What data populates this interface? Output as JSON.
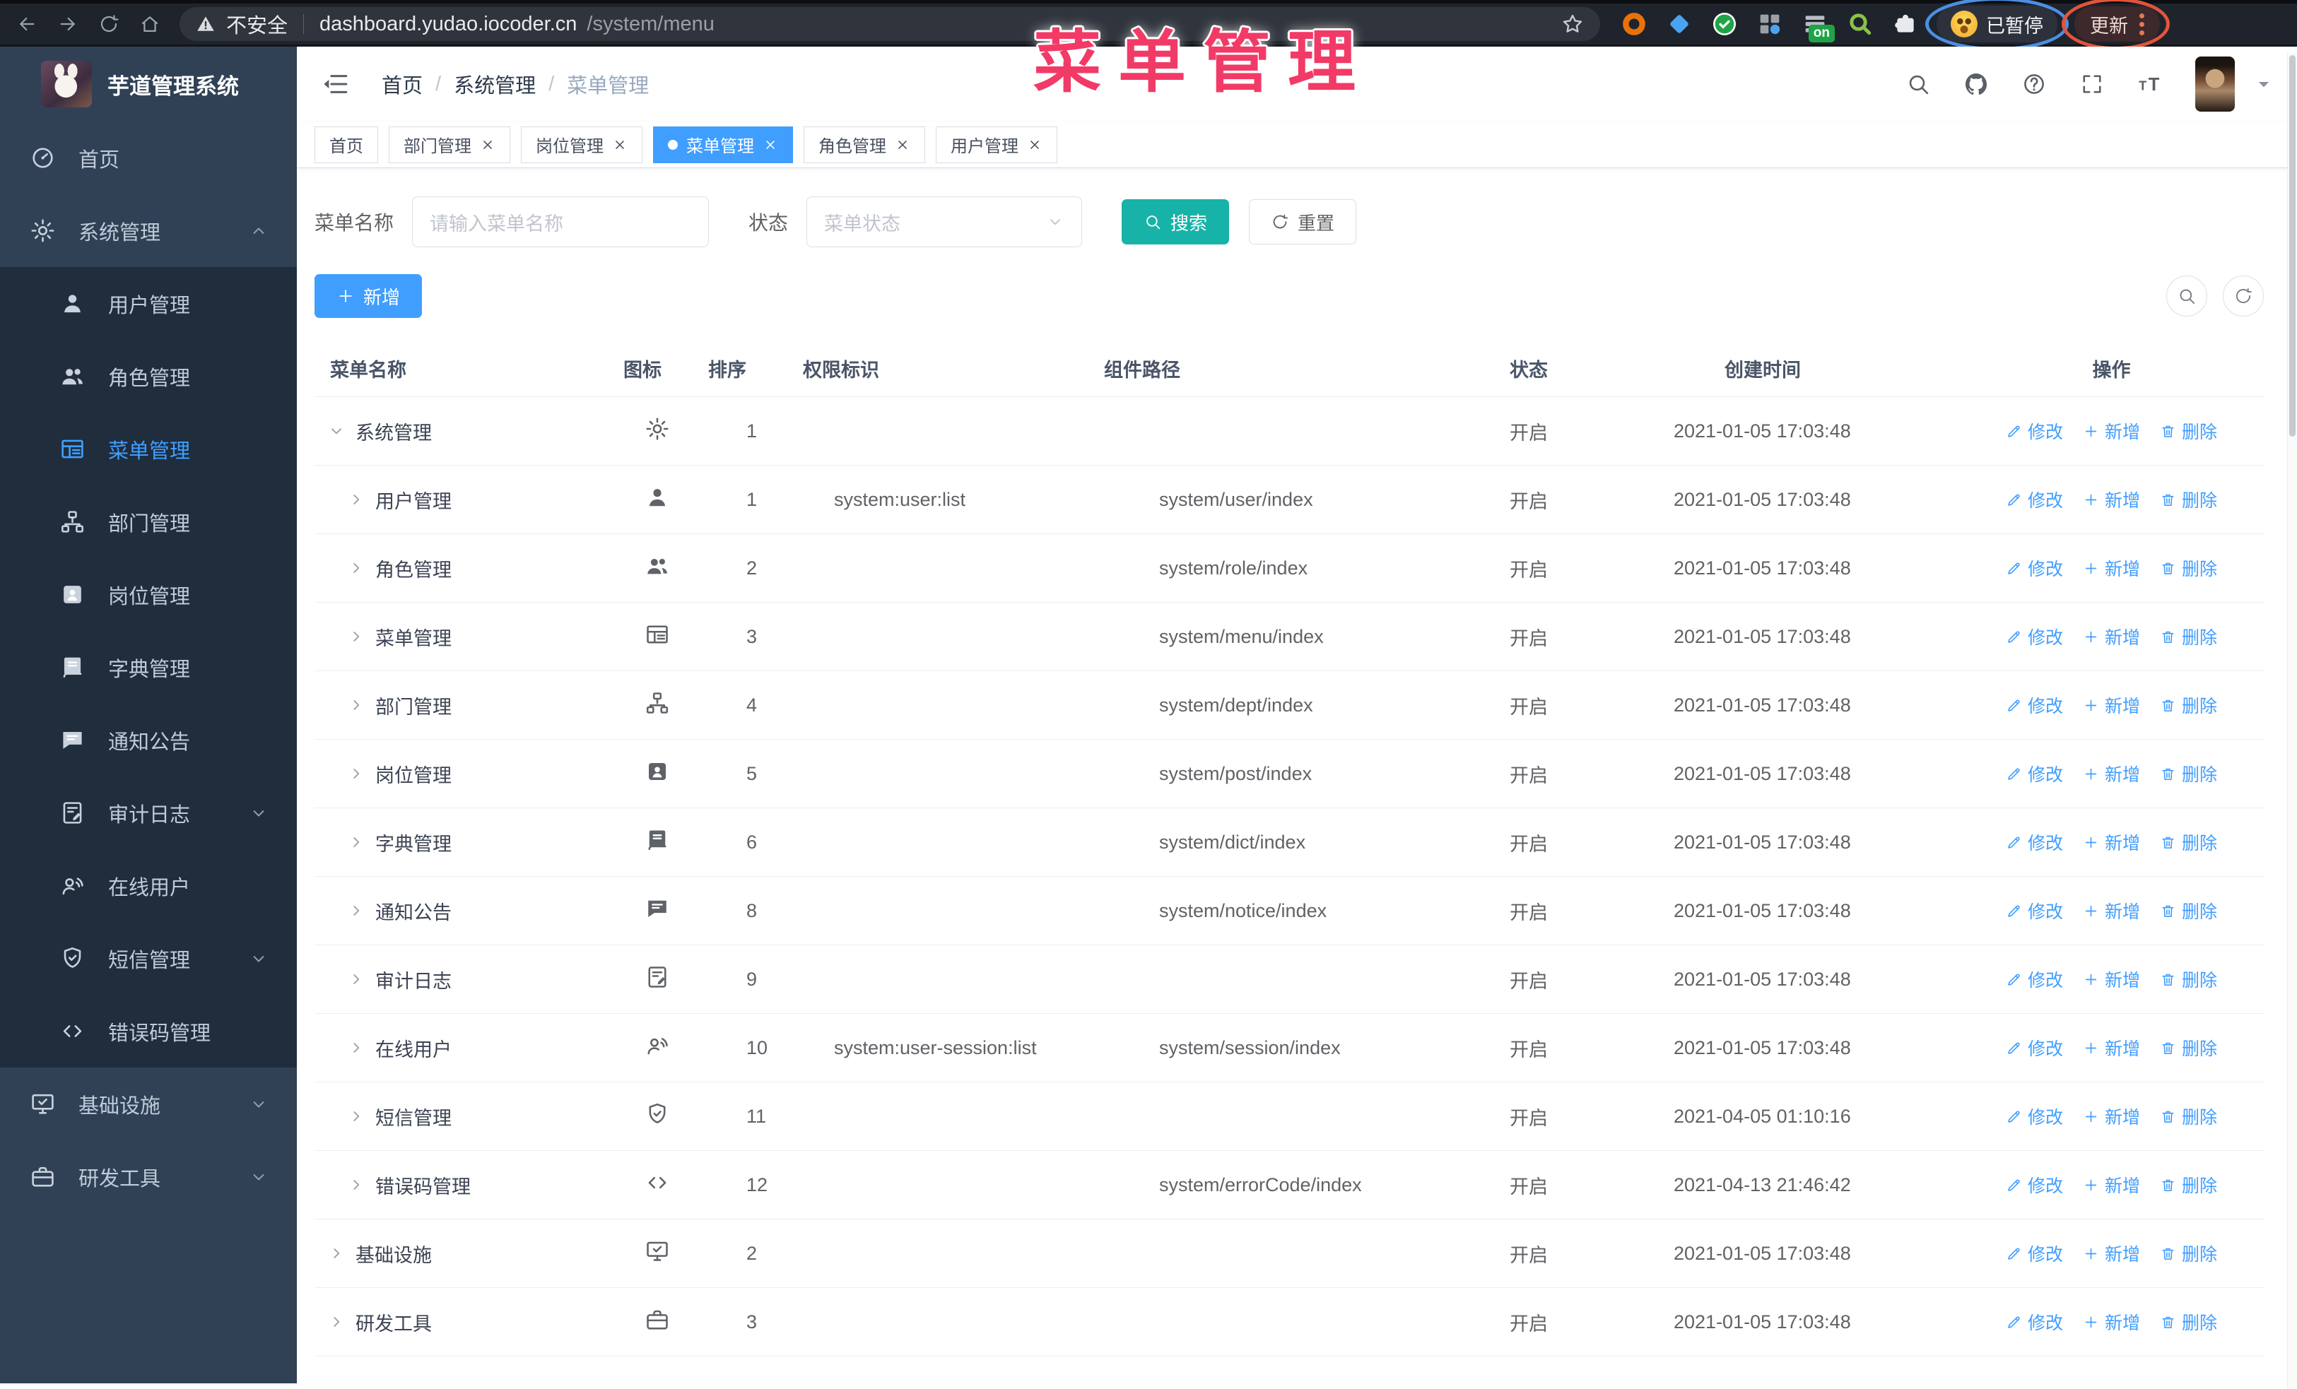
{
  "browser": {
    "security_label": "不安全",
    "url_host": "dashboard.yudao.iocoder.cn",
    "url_path": "/system/menu",
    "on_badge": "on",
    "paused_badge": "已暂停",
    "update_label": "更新"
  },
  "overlay_title": "菜单管理",
  "sidebar": {
    "logo_title": "芋道管理系统",
    "items": [
      {
        "label": "首页",
        "icon": "dashboard",
        "level": 1
      },
      {
        "label": "系统管理",
        "icon": "gear",
        "level": 1,
        "chevron": "up",
        "expanded": true
      },
      {
        "label": "用户管理",
        "icon": "user",
        "level": 2
      },
      {
        "label": "角色管理",
        "icon": "users",
        "level": 2
      },
      {
        "label": "菜单管理",
        "icon": "tree-table",
        "level": 2,
        "active": true
      },
      {
        "label": "部门管理",
        "icon": "tree",
        "level": 2
      },
      {
        "label": "岗位管理",
        "icon": "post",
        "level": 2
      },
      {
        "label": "字典管理",
        "icon": "dict",
        "level": 2
      },
      {
        "label": "通知公告",
        "icon": "message",
        "level": 2
      },
      {
        "label": "审计日志",
        "icon": "log",
        "level": 2,
        "chevron": "down"
      },
      {
        "label": "在线用户",
        "icon": "online",
        "level": 2
      },
      {
        "label": "短信管理",
        "icon": "sms",
        "level": 2,
        "chevron": "down"
      },
      {
        "label": "错误码管理",
        "icon": "code",
        "level": 2
      },
      {
        "label": "基础设施",
        "icon": "monitor",
        "level": 1,
        "chevron": "down"
      },
      {
        "label": "研发工具",
        "icon": "tool",
        "level": 1,
        "chevron": "down"
      }
    ]
  },
  "header": {
    "breadcrumb": [
      {
        "label": "首页",
        "current": false
      },
      {
        "label": "系统管理",
        "current": false
      },
      {
        "label": "菜单管理",
        "current": true
      }
    ]
  },
  "tabs": [
    {
      "label": "首页",
      "active": false,
      "closable": false
    },
    {
      "label": "部门管理",
      "active": false,
      "closable": true
    },
    {
      "label": "岗位管理",
      "active": false,
      "closable": true
    },
    {
      "label": "菜单管理",
      "active": true,
      "closable": true
    },
    {
      "label": "角色管理",
      "active": false,
      "closable": true
    },
    {
      "label": "用户管理",
      "active": false,
      "closable": true
    }
  ],
  "filters": {
    "name_label": "菜单名称",
    "name_placeholder": "请输入菜单名称",
    "status_label": "状态",
    "status_placeholder": "菜单状态",
    "search_label": "搜索",
    "reset_label": "重置"
  },
  "toolbar": {
    "add_label": "新增"
  },
  "table": {
    "columns": [
      "菜单名称",
      "图标",
      "排序",
      "权限标识",
      "组件路径",
      "状态",
      "创建时间",
      "操作"
    ],
    "action_labels": [
      "修改",
      "新增",
      "删除"
    ],
    "rows": [
      {
        "name": "系统管理",
        "icon": "gear",
        "level": 1,
        "expand": "open",
        "sort": "1",
        "perm": "",
        "path": "",
        "status": "开启",
        "time": "2021-01-05 17:03:48"
      },
      {
        "name": "用户管理",
        "icon": "user",
        "level": 2,
        "expand": "closed",
        "sort": "1",
        "perm": "system:user:list",
        "path": "system/user/index",
        "status": "开启",
        "time": "2021-01-05 17:03:48"
      },
      {
        "name": "角色管理",
        "icon": "users",
        "level": 2,
        "expand": "closed",
        "sort": "2",
        "perm": "",
        "path": "system/role/index",
        "status": "开启",
        "time": "2021-01-05 17:03:48"
      },
      {
        "name": "菜单管理",
        "icon": "tree-table",
        "level": 2,
        "expand": "closed",
        "sort": "3",
        "perm": "",
        "path": "system/menu/index",
        "status": "开启",
        "time": "2021-01-05 17:03:48"
      },
      {
        "name": "部门管理",
        "icon": "tree",
        "level": 2,
        "expand": "closed",
        "sort": "4",
        "perm": "",
        "path": "system/dept/index",
        "status": "开启",
        "time": "2021-01-05 17:03:48"
      },
      {
        "name": "岗位管理",
        "icon": "post",
        "level": 2,
        "expand": "closed",
        "sort": "5",
        "perm": "",
        "path": "system/post/index",
        "status": "开启",
        "time": "2021-01-05 17:03:48"
      },
      {
        "name": "字典管理",
        "icon": "dict",
        "level": 2,
        "expand": "closed",
        "sort": "6",
        "perm": "",
        "path": "system/dict/index",
        "status": "开启",
        "time": "2021-01-05 17:03:48"
      },
      {
        "name": "通知公告",
        "icon": "message",
        "level": 2,
        "expand": "closed",
        "sort": "8",
        "perm": "",
        "path": "system/notice/index",
        "status": "开启",
        "time": "2021-01-05 17:03:48"
      },
      {
        "name": "审计日志",
        "icon": "log",
        "level": 2,
        "expand": "closed",
        "sort": "9",
        "perm": "",
        "path": "",
        "status": "开启",
        "time": "2021-01-05 17:03:48"
      },
      {
        "name": "在线用户",
        "icon": "online",
        "level": 2,
        "expand": "closed",
        "sort": "10",
        "perm": "system:user-session:list",
        "path": "system/session/index",
        "status": "开启",
        "time": "2021-01-05 17:03:48"
      },
      {
        "name": "短信管理",
        "icon": "sms",
        "level": 2,
        "expand": "closed",
        "sort": "11",
        "perm": "",
        "path": "",
        "status": "开启",
        "time": "2021-04-05 01:10:16"
      },
      {
        "name": "错误码管理",
        "icon": "code",
        "level": 2,
        "expand": "closed",
        "sort": "12",
        "perm": "",
        "path": "system/errorCode/index",
        "status": "开启",
        "time": "2021-04-13 21:46:42"
      },
      {
        "name": "基础设施",
        "icon": "monitor",
        "level": 1,
        "expand": "closed",
        "sort": "2",
        "perm": "",
        "path": "",
        "status": "开启",
        "time": "2021-01-05 17:03:48"
      },
      {
        "name": "研发工具",
        "icon": "tool",
        "level": 1,
        "expand": "closed",
        "sort": "3",
        "perm": "",
        "path": "",
        "status": "开启",
        "time": "2021-01-05 17:03:48"
      }
    ]
  }
}
